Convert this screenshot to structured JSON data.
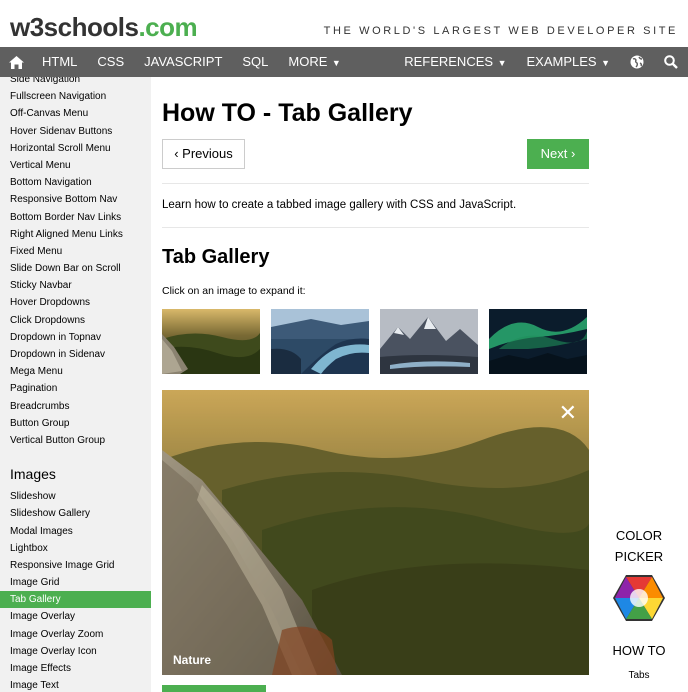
{
  "header": {
    "logo_main": "w3schools",
    "logo_suffix": ".com",
    "tagline": "THE WORLD'S LARGEST WEB DEVELOPER SITE"
  },
  "topnav": {
    "items": [
      "HTML",
      "CSS",
      "JAVASCRIPT",
      "SQL",
      "MORE"
    ],
    "right_items": [
      "REFERENCES",
      "EXAMPLES"
    ]
  },
  "sidebar": {
    "links_top": [
      "Side Navigation",
      "Fullscreen Navigation",
      "Off-Canvas Menu",
      "Hover Sidenav Buttons",
      "Horizontal Scroll Menu",
      "Vertical Menu",
      "Bottom Navigation",
      "Responsive Bottom Nav",
      "Bottom Border Nav Links",
      "Right Aligned Menu Links",
      "Fixed Menu",
      "Slide Down Bar on Scroll",
      "Sticky Navbar",
      "Hover Dropdowns",
      "Click Dropdowns",
      "Dropdown in Topnav",
      "Dropdown in Sidenav",
      "Mega Menu",
      "Pagination",
      "Breadcrumbs",
      "Button Group",
      "Vertical Button Group"
    ],
    "heading_images": "Images",
    "links_images": [
      "Slideshow",
      "Slideshow Gallery",
      "Modal Images",
      "Lightbox",
      "Responsive Image Grid",
      "Image Grid",
      "Tab Gallery",
      "Image Overlay",
      "Image Overlay Zoom",
      "Image Overlay Icon",
      "Image Effects",
      "Image Text"
    ],
    "active_label": "Tab Gallery"
  },
  "main": {
    "title": "How TO - Tab Gallery",
    "prev_label": "‹ Previous",
    "next_label": "Next ›",
    "intro": "Learn how to create a tabbed image gallery with CSS and JavaScript.",
    "section_title": "Tab Gallery",
    "click_note": "Click on an image to expand it:",
    "expanded_caption": "Nature",
    "close_symbol": "✕"
  },
  "right_col": {
    "color_picker_line1": "COLOR",
    "color_picker_line2": "PICKER",
    "howto_label": "HOW TO",
    "howto_sub": "Tabs"
  },
  "colors": {
    "brand_green": "#4CAF50",
    "nav_bg": "#5f5f5f",
    "sidebar_bg": "#f1f1f1"
  }
}
